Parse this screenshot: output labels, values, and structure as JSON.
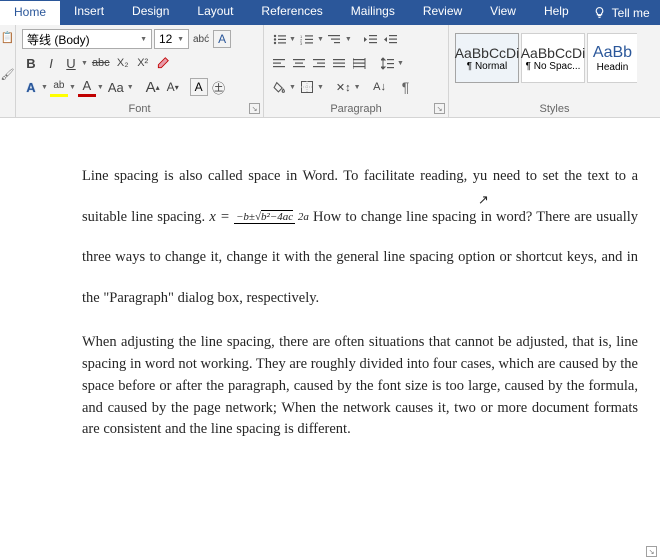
{
  "tabs": {
    "active": "Home",
    "items": [
      "Home",
      "Insert",
      "Design",
      "Layout",
      "References",
      "Mailings",
      "Review",
      "View",
      "Help"
    ],
    "tellme": "Tell me"
  },
  "font": {
    "family": "等线 (Body)",
    "size": "12",
    "bold": "B",
    "italic": "I",
    "underline": "U",
    "strike": "abc",
    "sub": "X₂",
    "sup": "X²",
    "clearfmt": "Aa",
    "growA": "A",
    "shrinkA": "A",
    "colorA": "A",
    "highlightA": "ab",
    "fontColorA": "A",
    "caseAa": "Aa",
    "boxA1": "A",
    "boxA2": "A",
    "label": "Font"
  },
  "para": {
    "sortIcon": "A↓",
    "pilcrow": "¶",
    "label": "Paragraph"
  },
  "styles": {
    "items": [
      {
        "preview": "AaBbCcDi",
        "name": "¶ Normal"
      },
      {
        "preview": "AaBbCcDi",
        "name": "¶ No Spac..."
      },
      {
        "preview": "AaBb",
        "name": "Headin"
      }
    ],
    "label": "Styles"
  },
  "doc": {
    "p1a": "Line spacing is also called space in Word. To facilitate reading, y",
    "p1b": "u need to set the text to a suitable line spacing. ",
    "eqx": "x =",
    "eqnum": "−b±√(b²−4ac)",
    "eqden": "2a",
    "p1c": " How to change line spacing in word? There are usually three ways to change it, change it with the general line spacing option or shortcut keys, and in the \"Paragraph\" dialog box, respectively.",
    "p2": "When adjusting the line spacing, there are often situations that cannot be adjusted, that is, line spacing in word not working. They are roughly divided into four cases, which are caused by the space before or after the paragraph, caused by the font size is too large, caused by the formula, and caused by the page network; When the network causes it, two or more document formats are consistent and the line spacing is different."
  }
}
